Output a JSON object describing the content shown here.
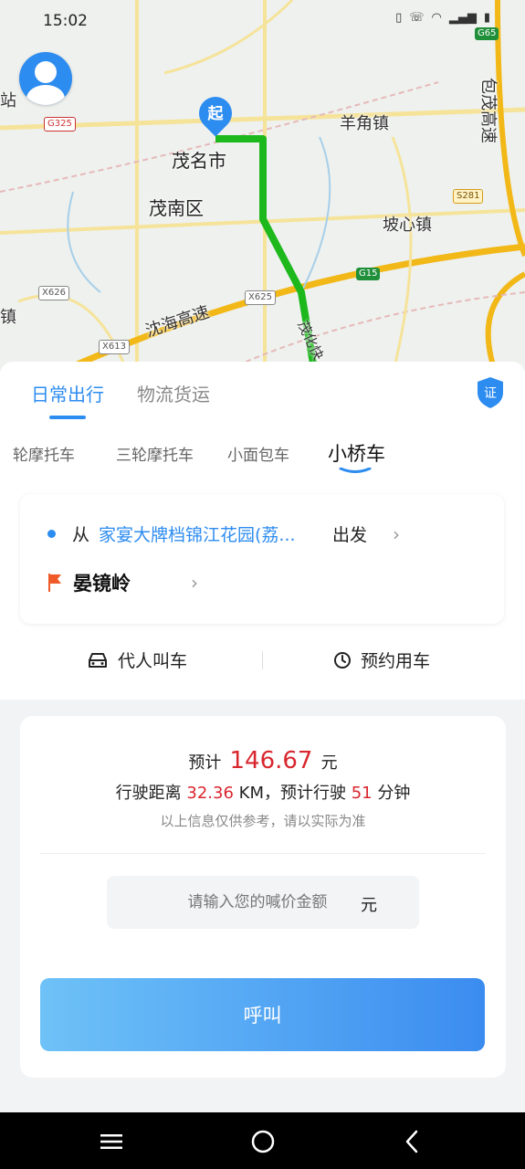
{
  "status_bar": {
    "time": "15:02"
  },
  "map": {
    "labels": {
      "maoming": "茂名市",
      "maonan": "茂南区",
      "yangjiao": "羊角镇",
      "poxin": "坡心镇",
      "shenhai": "沈海高速",
      "baomao": "包茂高速",
      "maoqiu": "茂化快",
      "zhan": "站",
      "zhen": "镇"
    },
    "badges": {
      "g325": "G325",
      "g65": "G65",
      "s281": "S281",
      "g15": "G15",
      "x626": "X626",
      "x625": "X625",
      "x613": "X613"
    },
    "start_marker": "起",
    "route_color": "#1cb81c"
  },
  "panel": {
    "tabs": [
      {
        "label": "日常出行",
        "active": true
      },
      {
        "label": "物流货运",
        "active": false
      }
    ],
    "cert_badge": "证",
    "vehicle_types": [
      {
        "label": "轮摩托车",
        "active": false
      },
      {
        "label": "三轮摩托车",
        "active": false
      },
      {
        "label": "小面包车",
        "active": false
      },
      {
        "label": "小桥车",
        "active": true
      }
    ],
    "route": {
      "from_prefix": "从",
      "from_place": "家宴大牌档锦江花园(荔...",
      "from_suffix": "出发",
      "to_place": "晏镜岭"
    },
    "actions": {
      "proxy": "代人叫车",
      "reserve": "预约用车"
    }
  },
  "price": {
    "est_label": "预计",
    "amount": "146.67",
    "unit": "元",
    "distance_prefix": "行驶距离",
    "distance": "32.36",
    "distance_unit": "KM，预计行驶",
    "minutes": "51",
    "minutes_unit": "分钟",
    "note": "以上信息仅供参考，请以实际为准",
    "bid_placeholder": "请输入您的喊价金额",
    "bid_unit": "元",
    "call_button": "呼叫"
  },
  "colors": {
    "accent": "#2d8cf0",
    "price_red": "#d9272e"
  }
}
